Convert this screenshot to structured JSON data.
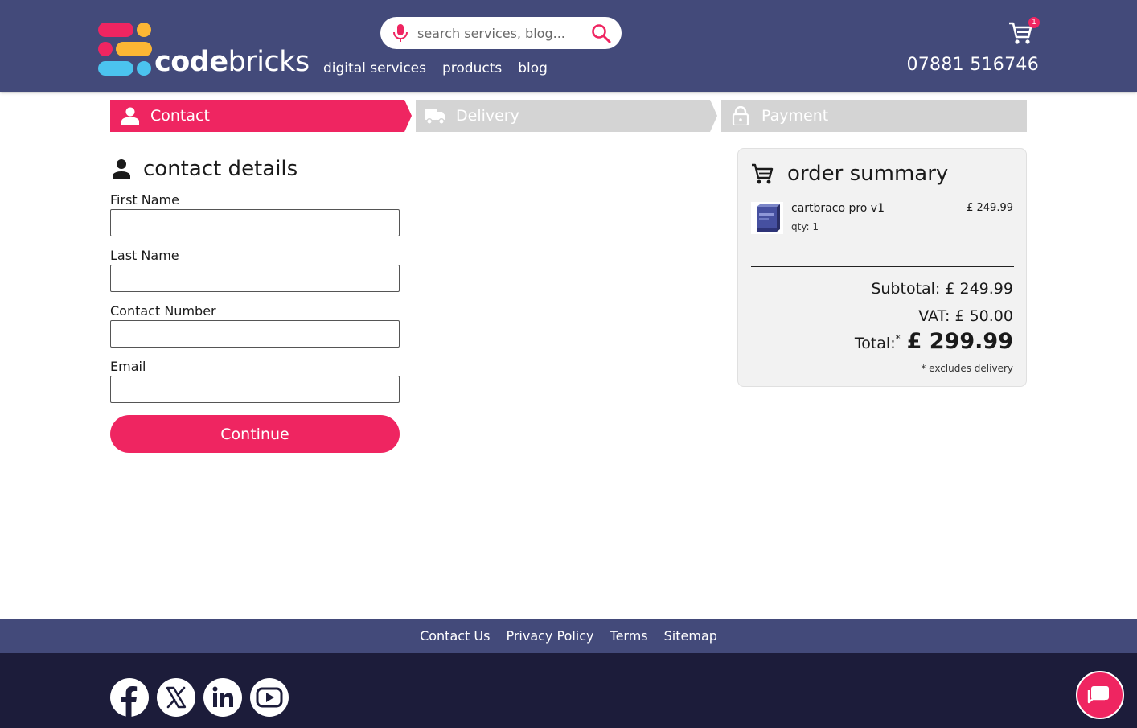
{
  "brand": {
    "logo_bold": "code",
    "logo_light": "bricks",
    "colors": {
      "primary": "#434a7a",
      "accent": "#ef2561",
      "yellow": "#fcb634",
      "blue": "#4bc3ef",
      "dark": "#1c1c3a"
    }
  },
  "header": {
    "search_placeholder": "search services, blog...",
    "mic_icon": "microphone-icon",
    "search_icon": "search-icon",
    "nav": [
      "digital services",
      "products",
      "blog"
    ],
    "cart_count": "1",
    "phone": "07881 516746"
  },
  "steps": [
    {
      "label": "Contact",
      "icon": "person-icon",
      "active": true
    },
    {
      "label": "Delivery",
      "icon": "truck-icon",
      "active": false
    },
    {
      "label": "Payment",
      "icon": "lock-icon",
      "active": false
    }
  ],
  "contact": {
    "heading": "contact details",
    "fields": [
      {
        "label": "First Name",
        "value": ""
      },
      {
        "label": "Last Name",
        "value": ""
      },
      {
        "label": "Contact Number",
        "value": ""
      },
      {
        "label": "Email",
        "value": ""
      }
    ],
    "continue_label": "Continue"
  },
  "summary": {
    "heading": "order summary",
    "product": {
      "name": "cartbraco pro v1",
      "qty": "qty: 1",
      "price": "£ 249.99"
    },
    "subtotal": "Subtotal: £ 249.99",
    "vat": "VAT: £ 50.00",
    "total_label": "Total:",
    "total_mark": "*",
    "total_value": "£ 299.99",
    "note": "* excludes delivery"
  },
  "footer": {
    "links": [
      "Contact Us",
      "Privacy Policy",
      "Terms",
      "Sitemap"
    ],
    "social": [
      "facebook-icon",
      "x-icon",
      "linkedin-icon",
      "youtube-icon"
    ]
  }
}
